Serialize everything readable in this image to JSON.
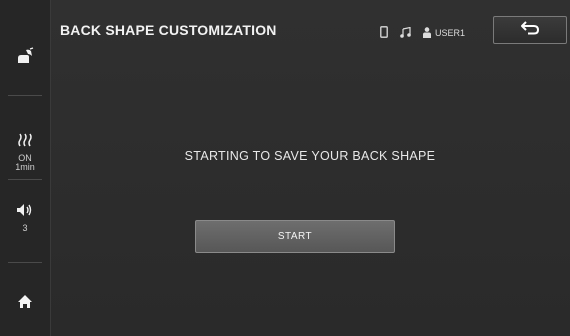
{
  "header": {
    "title": "BACK SHAPE CUSTOMIZATION",
    "user_label": "USER1",
    "icons": [
      "phone-icon",
      "music-note-icon",
      "user-icon",
      "back-arrow-icon"
    ]
  },
  "sidebar": {
    "seat_icon": "seat-massage-icon",
    "heat": {
      "icon": "heat-waves-icon",
      "status": "ON",
      "timer": "1min"
    },
    "volume": {
      "icon": "speaker-icon",
      "level": "3"
    },
    "home_icon": "home-icon"
  },
  "main": {
    "message": "STARTING TO SAVE YOUR BACK SHAPE",
    "start_label": "START"
  },
  "colors": {
    "background": "#2b2b2b",
    "button": "#636363",
    "text": "#e6e6e6"
  }
}
